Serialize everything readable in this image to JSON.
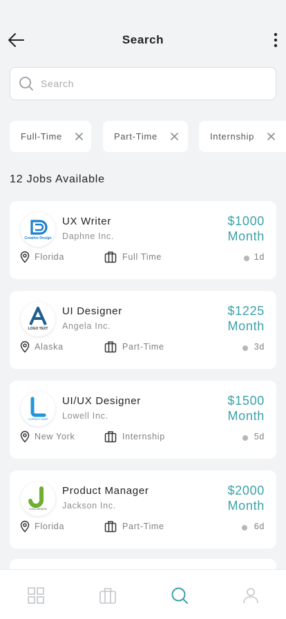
{
  "header": {
    "title": "Search"
  },
  "search": {
    "placeholder": "Search",
    "value": ""
  },
  "filters": [
    "Full-Time",
    "Part-Time",
    "Internship"
  ],
  "results": {
    "count_label": "12 Jobs Available"
  },
  "jobs": [
    {
      "title": "UX Writer",
      "company": "Daphne Inc.",
      "salary_amount": "$1000",
      "salary_period": "Month",
      "location": "Florida",
      "type": "Full Time",
      "posted": "1d",
      "logo_text": "Creative Design"
    },
    {
      "title": "UI Designer",
      "company": "Angela Inc.",
      "salary_amount": "$1225",
      "salary_period": "Month",
      "location": "Alaska",
      "type": "Part-Time",
      "posted": "3d",
      "logo_text": "LOGO TEXT"
    },
    {
      "title": "UI/UX Designer",
      "company": "Lowell Inc.",
      "salary_amount": "$1500",
      "salary_period": "Month",
      "location": "New York",
      "type": "Internship",
      "posted": "5d",
      "logo_text": "COMPANY NAME"
    },
    {
      "title": "Product Manager",
      "company": "Jackson Inc.",
      "salary_amount": "$2000",
      "salary_period": "Month",
      "location": "Florida",
      "type": "Part-Time",
      "posted": "6d",
      "logo_text": "LOGO DESIGN"
    }
  ],
  "nav": {
    "items": [
      "grid-icon",
      "briefcase-icon",
      "search-icon",
      "profile-icon"
    ],
    "active": "search-icon"
  },
  "colors": {
    "accent": "#3aa1a9",
    "background": "#f2f3f5",
    "card": "#ffffff"
  }
}
